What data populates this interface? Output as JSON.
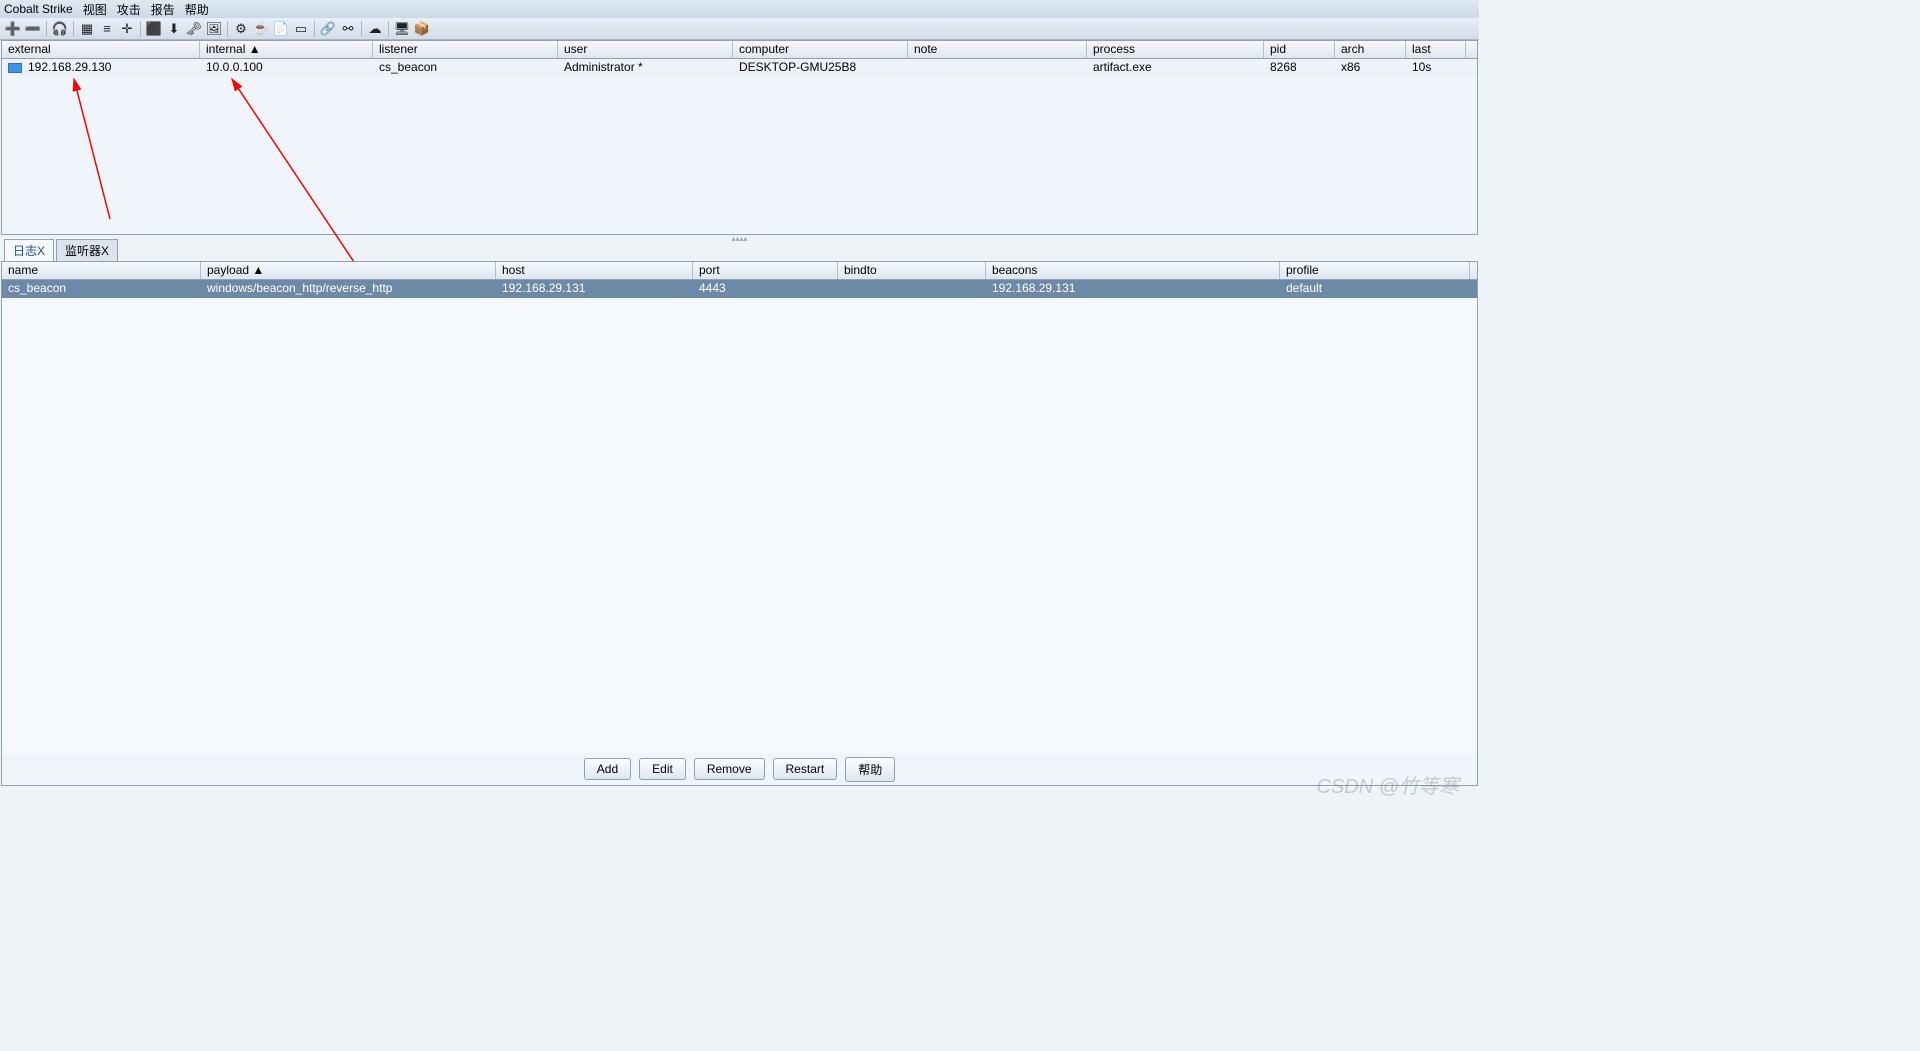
{
  "menu": [
    "Cobalt Strike",
    "视图",
    "攻击",
    "报告",
    "帮助"
  ],
  "sessions": {
    "columns": [
      "external",
      "internal ▲",
      "listener",
      "user",
      "computer",
      "note",
      "process",
      "pid",
      "arch",
      "last"
    ],
    "widths": [
      198,
      173,
      185,
      175,
      175,
      179,
      177,
      71,
      71,
      60
    ],
    "row": {
      "external": "192.168.29.130",
      "internal": "10.0.0.100",
      "listener": "cs_beacon",
      "user": "Administrator *",
      "computer": "DESKTOP-GMU25B8",
      "note": "",
      "process": "artifact.exe",
      "pid": "8268",
      "arch": "x86",
      "last": "10s"
    }
  },
  "tabs": {
    "log": "日志X",
    "listeners": "监听器X"
  },
  "listeners": {
    "columns": [
      "name",
      "payload ▲",
      "host",
      "port",
      "bindto",
      "beacons",
      "profile"
    ],
    "widths": [
      199,
      295,
      197,
      145,
      148,
      294,
      190
    ],
    "row": {
      "name": "cs_beacon",
      "payload": "windows/beacon_http/reverse_http",
      "host": "192.168.29.131",
      "port": "4443",
      "bindto": "",
      "beacons": "192.168.29.131",
      "profile": "default"
    }
  },
  "buttons": {
    "add": "Add",
    "edit": "Edit",
    "remove": "Remove",
    "restart": "Restart",
    "help": "帮助"
  },
  "watermark": "CSDN @竹等寒"
}
